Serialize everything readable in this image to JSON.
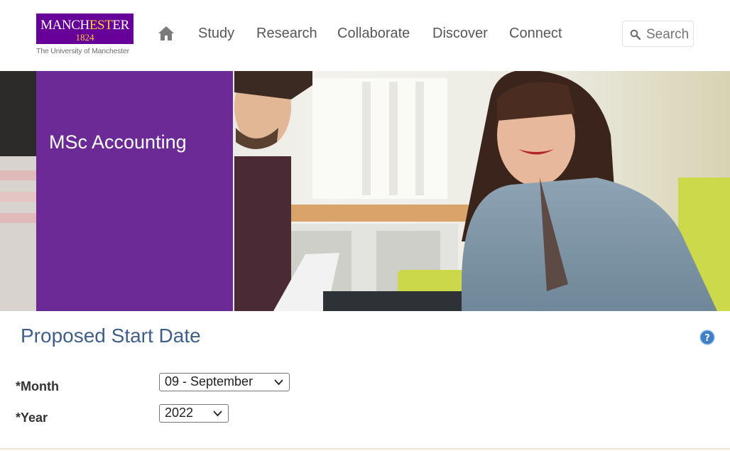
{
  "logo": {
    "name_part1": "MANCH",
    "name_part2": "EST",
    "name_part3": "ER",
    "year": "1824",
    "subtitle": "The University of Manchester"
  },
  "nav": {
    "items": [
      {
        "label": "Study"
      },
      {
        "label": "Research"
      },
      {
        "label": "Collaborate"
      },
      {
        "label": "Discover"
      },
      {
        "label": "Connect"
      }
    ]
  },
  "search": {
    "label": "Search"
  },
  "hero": {
    "title": "MSc Accounting"
  },
  "form": {
    "section_title": "Proposed Start Date",
    "month": {
      "label": "*Month",
      "value": "09 - September"
    },
    "year": {
      "label": "*Year",
      "value": "2022"
    }
  },
  "colors": {
    "brand_purple": "#660099",
    "brand_gold": "#ffcc33",
    "title_blue": "#3f5f8a"
  },
  "icons": {
    "home": "home-icon",
    "search": "search-icon",
    "help": "help-icon",
    "chevron": "chevron-down-icon"
  }
}
